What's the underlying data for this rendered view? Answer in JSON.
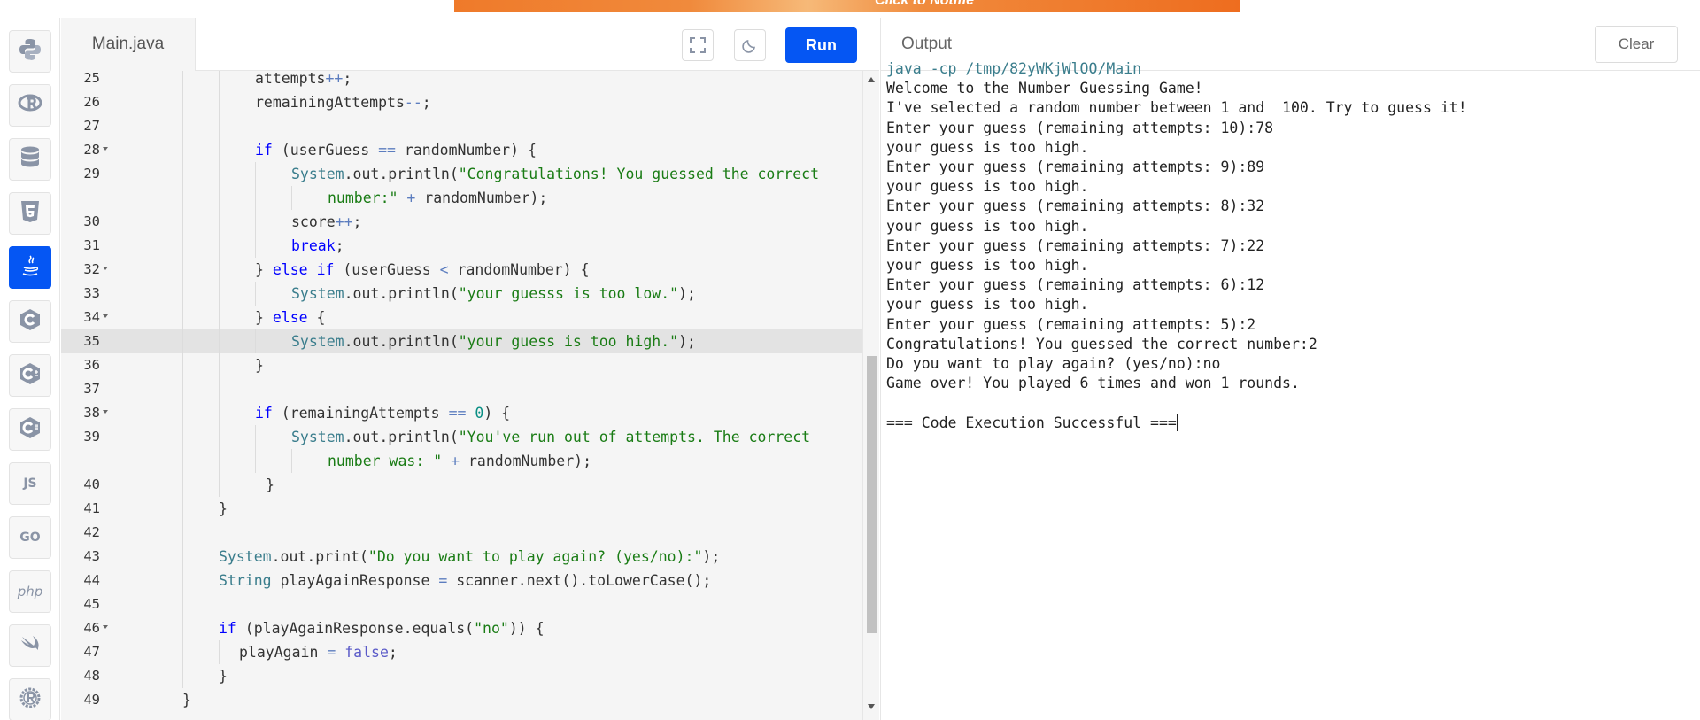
{
  "banner": {
    "text": "Click to Notifie"
  },
  "sidebar": {
    "languages": [
      {
        "name": "python-icon",
        "label": ""
      },
      {
        "name": "r-icon",
        "label": ""
      },
      {
        "name": "database-icon",
        "label": ""
      },
      {
        "name": "html5-icon",
        "label": ""
      },
      {
        "name": "java-icon",
        "label": "",
        "active": true
      },
      {
        "name": "c-icon",
        "label": ""
      },
      {
        "name": "cpp-icon",
        "label": ""
      },
      {
        "name": "csharp-icon",
        "label": ""
      },
      {
        "name": "javascript-icon",
        "label": "JS"
      },
      {
        "name": "go-icon",
        "label": "GO"
      },
      {
        "name": "php-icon",
        "label": "php"
      },
      {
        "name": "swift-icon",
        "label": ""
      },
      {
        "name": "rust-icon",
        "label": ""
      }
    ]
  },
  "editor": {
    "file_name": "Main.java",
    "run_label": "Run",
    "highlighted_line": "35",
    "lines": [
      {
        "n": "25",
        "indent": 4,
        "tokens": [
          [
            "attempts",
            ""
          ],
          [
            "++",
            "op"
          ],
          [
            ";",
            ""
          ]
        ]
      },
      {
        "n": "26",
        "indent": 4,
        "tokens": [
          [
            "remainingAttempts",
            ""
          ],
          [
            "--",
            "op"
          ],
          [
            ";",
            ""
          ]
        ]
      },
      {
        "n": "27",
        "indent": 4,
        "tokens": []
      },
      {
        "n": "28",
        "indent": 4,
        "fold": true,
        "tokens": [
          [
            "if",
            "kw"
          ],
          [
            " (userGuess ",
            ""
          ],
          [
            "==",
            "op"
          ],
          [
            " randomNumber) {",
            ""
          ]
        ]
      },
      {
        "n": "29",
        "indent": 5,
        "tokens": [
          [
            "System",
            "cls"
          ],
          [
            ".out.println(",
            ""
          ],
          [
            "\"Congratulations! You guessed the correct",
            "str"
          ]
        ]
      },
      {
        "n": "",
        "indent": 6,
        "tokens": [
          [
            "number:\"",
            "str"
          ],
          [
            " ",
            ""
          ],
          [
            "+",
            "op"
          ],
          [
            " randomNumber);",
            ""
          ]
        ]
      },
      {
        "n": "30",
        "indent": 5,
        "tokens": [
          [
            "score",
            ""
          ],
          [
            "++",
            "op"
          ],
          [
            ";",
            ""
          ]
        ]
      },
      {
        "n": "31",
        "indent": 5,
        "tokens": [
          [
            "break",
            "kw"
          ],
          [
            ";",
            ""
          ]
        ]
      },
      {
        "n": "32",
        "indent": 4,
        "fold": true,
        "tokens": [
          [
            "} ",
            ""
          ],
          [
            "else",
            "kw"
          ],
          [
            " ",
            ""
          ],
          [
            "if",
            "kw"
          ],
          [
            " (userGuess ",
            ""
          ],
          [
            "<",
            "op"
          ],
          [
            " randomNumber) {",
            ""
          ]
        ]
      },
      {
        "n": "33",
        "indent": 5,
        "tokens": [
          [
            "System",
            "cls"
          ],
          [
            ".out.println(",
            ""
          ],
          [
            "\"your guesss is too low.\"",
            "str"
          ],
          [
            ");",
            ""
          ]
        ]
      },
      {
        "n": "34",
        "indent": 4,
        "fold": true,
        "tokens": [
          [
            "} ",
            ""
          ],
          [
            "else",
            "kw"
          ],
          [
            " {",
            ""
          ]
        ]
      },
      {
        "n": "35",
        "indent": 5,
        "tokens": [
          [
            "System",
            "cls"
          ],
          [
            ".out.println(",
            ""
          ],
          [
            "\"your guess is too high.\"",
            "str"
          ],
          [
            ");",
            ""
          ]
        ]
      },
      {
        "n": "36",
        "indent": 4,
        "tokens": [
          [
            "}",
            ""
          ]
        ]
      },
      {
        "n": "37",
        "indent": 4,
        "tokens": []
      },
      {
        "n": "38",
        "indent": 4,
        "fold": true,
        "tokens": [
          [
            "if",
            "kw"
          ],
          [
            " (remainingAttempts ",
            ""
          ],
          [
            "==",
            "op"
          ],
          [
            " ",
            ""
          ],
          [
            "0",
            "num"
          ],
          [
            ") {",
            ""
          ]
        ]
      },
      {
        "n": "39",
        "indent": 5,
        "tokens": [
          [
            "System",
            "cls"
          ],
          [
            ".out.println(",
            ""
          ],
          [
            "\"You've run out of attempts. The correct",
            "str"
          ]
        ]
      },
      {
        "n": "",
        "indent": 6,
        "tokens": [
          [
            "number was: \"",
            "str"
          ],
          [
            " ",
            ""
          ],
          [
            "+",
            "op"
          ],
          [
            " randomNumber);",
            ""
          ]
        ]
      },
      {
        "n": "40",
        "indent": 4,
        "extra": 12,
        "tokens": [
          [
            "}",
            ""
          ]
        ]
      },
      {
        "n": "41",
        "indent": 3,
        "tokens": [
          [
            "}",
            ""
          ]
        ]
      },
      {
        "n": "42",
        "indent": 3,
        "tokens": []
      },
      {
        "n": "43",
        "indent": 3,
        "tokens": [
          [
            "System",
            "cls"
          ],
          [
            ".out.print(",
            ""
          ],
          [
            "\"Do you want to play again? (yes/no):\"",
            "str"
          ],
          [
            ");",
            ""
          ]
        ]
      },
      {
        "n": "44",
        "indent": 3,
        "tokens": [
          [
            "String",
            "cls"
          ],
          [
            " playAgainResponse ",
            ""
          ],
          [
            "=",
            "op"
          ],
          [
            " scanner.next().toLowerCase();",
            ""
          ]
        ]
      },
      {
        "n": "45",
        "indent": 3,
        "tokens": []
      },
      {
        "n": "46",
        "indent": 3,
        "fold": true,
        "tokens": [
          [
            "if",
            "kw"
          ],
          [
            " (playAgainResponse.equals(",
            ""
          ],
          [
            "\"no\"",
            "str"
          ],
          [
            ")) {",
            ""
          ]
        ]
      },
      {
        "n": "47",
        "indent": 4,
        "extra": -18,
        "tokens": [
          [
            "playAgain ",
            ""
          ],
          [
            "=",
            "op"
          ],
          [
            " ",
            ""
          ],
          [
            "false",
            "lit"
          ],
          [
            ";",
            ""
          ]
        ]
      },
      {
        "n": "48",
        "indent": 3,
        "tokens": [
          [
            "}",
            ""
          ]
        ]
      },
      {
        "n": "49",
        "indent": 2,
        "tokens": [
          [
            "}",
            ""
          ]
        ]
      }
    ]
  },
  "output": {
    "title": "Output",
    "clear_label": "Clear",
    "lines": [
      "java -cp /tmp/82yWKjWlOO/Main",
      "Welcome to the Number Guessing Game!",
      "I've selected a random number between 1 and  100. Try to guess it!",
      "Enter your guess (remaining attempts: 10):78",
      "your guess is too high.",
      "Enter your guess (remaining attempts: 9):89",
      "your guess is too high.",
      "Enter your guess (remaining attempts: 8):32",
      "your guess is too high.",
      "Enter your guess (remaining attempts: 7):22",
      "your guess is too high.",
      "Enter your guess (remaining attempts: 6):12",
      "your guess is too high.",
      "Enter your guess (remaining attempts: 5):2",
      "Congratulations! You guessed the correct number:2",
      "Do you want to play again? (yes/no):no",
      "Game over! You played 6 times and won 1 rounds.",
      "",
      "=== Code Execution Successful ==="
    ]
  },
  "colors": {
    "accent": "#0556f3",
    "string": "#1a7c15",
    "keyword": "#0000ff"
  }
}
